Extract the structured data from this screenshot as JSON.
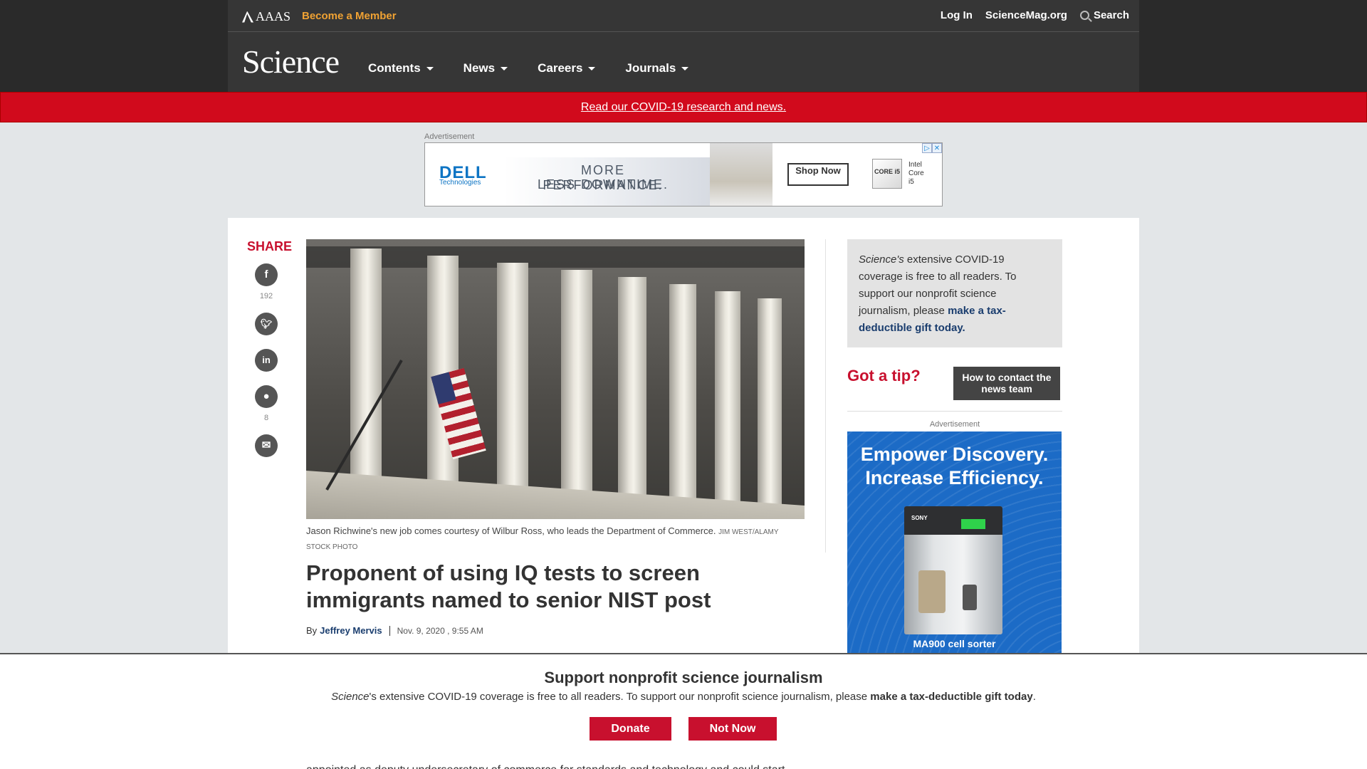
{
  "header": {
    "aaas": "AAAS",
    "become_member": "Become a Member",
    "login": "Log In",
    "sciencemag": "ScienceMag.org",
    "search": "Search",
    "logo": "Science",
    "nav": [
      "Contents",
      "News",
      "Careers",
      "Journals"
    ]
  },
  "banner": {
    "covid_link": "Read our COVID-19 research and news."
  },
  "top_ad": {
    "label": "Advertisement",
    "brand": "DELL",
    "brand_sub": "Technologies",
    "line1": "MORE PERFORMANCE.",
    "line2": "LESS DOWNTIME.",
    "cta": "Shop Now",
    "chip": "CORE i5",
    "chip_text": "Intel Core i5"
  },
  "share": {
    "title": "SHARE",
    "facebook_count": "192",
    "reddit_count": "8"
  },
  "article": {
    "caption": "Jason Richwine's new job comes courtesy of Wilbur Ross, who leads the Department of Commerce.",
    "credit": "Jim West/Alamy Stock Photo",
    "headline": "Proponent of using IQ tests to screen immigrants named to senior NIST post",
    "by": "By",
    "author": "Jeffrey Mervis",
    "date": "Nov. 9, 2020 , 9:55 AM",
    "body_peek": "appointed as deputy undersecretary of commerce for standards and technology and could start"
  },
  "sidebar": {
    "science_label": "Science's",
    "text": " extensive COVID-19 coverage is free to all readers. To support our nonprofit science journalism, please ",
    "gift_link": "make a tax-deductible gift today.",
    "tip": "Got a tip?",
    "contact_button": "How to contact the news team",
    "ad_label": "Advertisement",
    "ad_headline": "Empower Discovery. Increase Efficiency.",
    "ad_product": "MA900 cell sorter",
    "ad_brand": "SONY"
  },
  "support_bar": {
    "title": "Support nonprofit science journalism",
    "science_label": "Science",
    "text": "'s extensive COVID-19 coverage is free to all readers. To support our nonprofit science journalism, please ",
    "gift": "make a tax-deductible gift today",
    "period": ".",
    "donate": "Donate",
    "not_now": "Not Now"
  }
}
